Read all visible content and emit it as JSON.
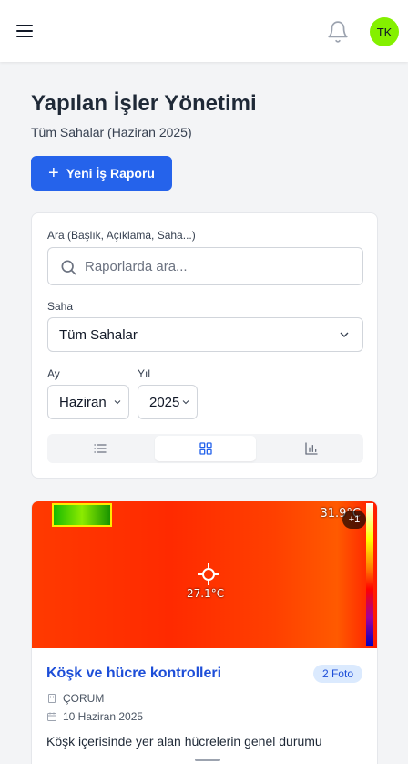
{
  "header": {
    "menu_icon": "hamburger-icon",
    "notification_icon": "bell-icon",
    "avatar_initials": "TK",
    "avatar_color": "#84f000"
  },
  "page": {
    "title": "Yapılan İşler Yönetimi",
    "subtitle": "Tüm Sahalar (Haziran 2025)",
    "new_report_label": "Yeni İş Raporu",
    "accent": "#2563eb"
  },
  "filters": {
    "search_label": "Ara (Başlık, Açıklama, Saha...)",
    "search_placeholder": "Raporlarda ara...",
    "site_label": "Saha",
    "site_value": "Tüm Sahalar",
    "month_label": "Ay",
    "month_value": "Haziran",
    "year_label": "Yıl",
    "year_value": "2025",
    "views": [
      "list-icon",
      "grid-icon",
      "chart-icon"
    ],
    "active_view": "grid-icon"
  },
  "report": {
    "image_temp_top": "31.9°C",
    "image_temp_center": "27.1°C",
    "extra_photos": "+1",
    "title": "Köşk ve hücre kontrolleri",
    "photo_count": "2 Foto",
    "site": "ÇORUM",
    "date": "10 Haziran 2025",
    "description": "Köşk içerisinde yer alan hücrelerin genel durumu"
  }
}
